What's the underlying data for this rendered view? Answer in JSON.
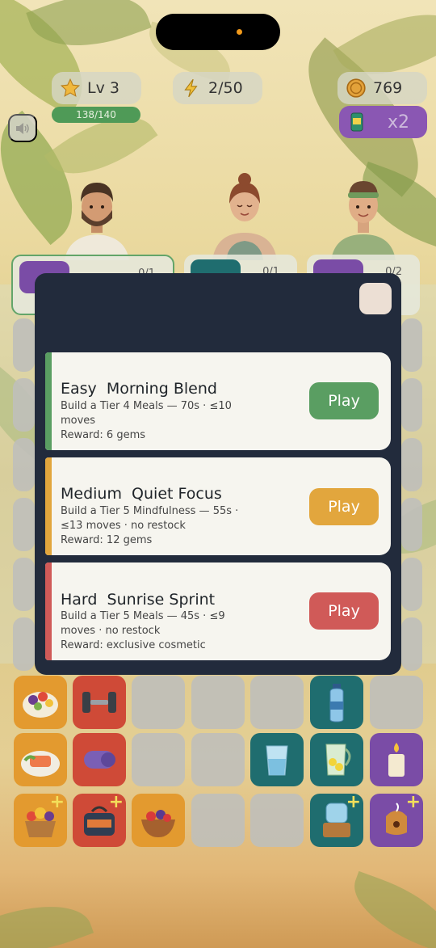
{
  "hud": {
    "level": "Lv 3",
    "xp": "138/140",
    "energy": "2/50",
    "coins": "769",
    "boost": "x2"
  },
  "orders": [
    {
      "count": "0/1"
    },
    {
      "count": "0/1"
    },
    {
      "count": "0/2"
    }
  ],
  "challenges": [
    {
      "difficulty": "Easy",
      "name": "Morning Blend",
      "title": "Easy  Morning Blend",
      "description": "Build a Tier 4 Meals — 70s · ≤10 moves",
      "reward": "Reward: 6 gems",
      "button": "Play",
      "color": "#5a9e62"
    },
    {
      "difficulty": "Medium",
      "name": "Quiet Focus",
      "title": "Medium  Quiet Focus",
      "description": "Build a Tier 5 Mindfulness — 55s · ≤13 moves · no restock",
      "reward": "Reward: 12 gems",
      "button": "Play",
      "color": "#e2a63d"
    },
    {
      "difficulty": "Hard",
      "name": "Sunrise Sprint",
      "title": "Hard  Sunrise Sprint",
      "description": "Build a Tier 5 Meals — 45s · ≤9 moves · no restock",
      "reward": "Reward: exclusive cosmetic",
      "button": "Play",
      "color": "#d05a58"
    }
  ],
  "board_items": [
    "fruit-bowl-icon",
    "dumbbell-icon",
    "water-bottle-icon",
    "salmon-plate-icon",
    "yoga-mat-icon",
    "water-glass-icon",
    "lemon-pitcher-icon",
    "candle-icon",
    "fruit-basket-icon",
    "gym-bag-icon",
    "berry-bowl-icon",
    "water-dispenser-icon",
    "incense-burner-icon"
  ],
  "colors": {
    "modal_bg": "#222b3c",
    "card_bg": "#f6f5ef",
    "tile_orange": "#e39a2f",
    "tile_red": "#cf4a37",
    "tile_teal": "#1f6d6f",
    "tile_purple": "#7a4ca6"
  }
}
